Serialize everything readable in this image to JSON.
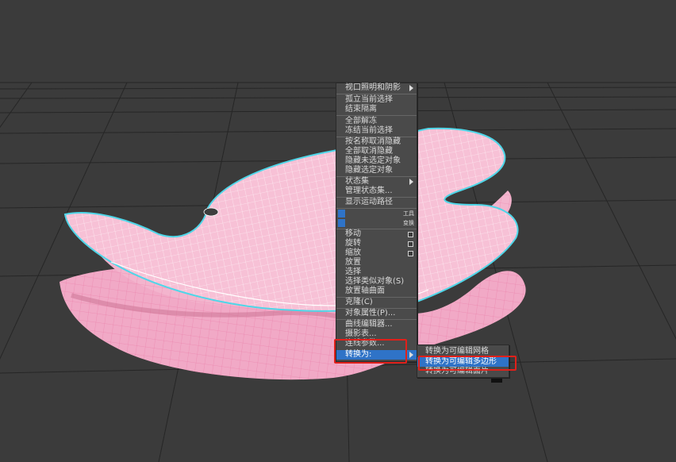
{
  "quad_menu": {
    "items": [
      {
        "label": "视口照明和阴影",
        "submenu": true
      },
      {
        "label": "孤立当前选择"
      },
      {
        "label": "结束隔离"
      },
      {
        "label": "全部解冻"
      },
      {
        "label": "冻结当前选择"
      },
      {
        "label": "按名称取消隐藏"
      },
      {
        "label": "全部取消隐藏"
      },
      {
        "label": "隐藏未选定对象"
      },
      {
        "label": "隐藏选定对象"
      },
      {
        "label": "状态集",
        "submenu": true
      },
      {
        "label": "管理状态集..."
      },
      {
        "label": "显示运动路径"
      },
      {
        "label": "移动",
        "box": true
      },
      {
        "label": "旋转",
        "box": true
      },
      {
        "label": "缩放",
        "box": true
      },
      {
        "label": "放置"
      },
      {
        "label": "选择"
      },
      {
        "label": "选择类似对象(S)"
      },
      {
        "label": "放置轴曲面"
      },
      {
        "label": "克隆(C)"
      },
      {
        "label": "对象属性(P)..."
      },
      {
        "label": "曲线编辑器..."
      },
      {
        "label": "摄影表..."
      },
      {
        "label": "连线参数..."
      },
      {
        "label": "转换为:",
        "submenu": true,
        "highlighted": true
      }
    ],
    "quad_labels": [
      "工具",
      "变换"
    ]
  },
  "submenu": {
    "items": [
      {
        "label": "转换为可编辑网格"
      },
      {
        "label": "转换为可编辑多边形",
        "highlighted": true
      },
      {
        "label": "转换为可编辑面片"
      }
    ]
  },
  "colors": {
    "background": "#3b3b3b",
    "menu_bg": "#4a4a4a",
    "highlight": "#2f73c7",
    "mesh_pink": "#f1a9c6",
    "selection_outline": "#4fd6e8",
    "annotation_red": "#e0201a"
  }
}
